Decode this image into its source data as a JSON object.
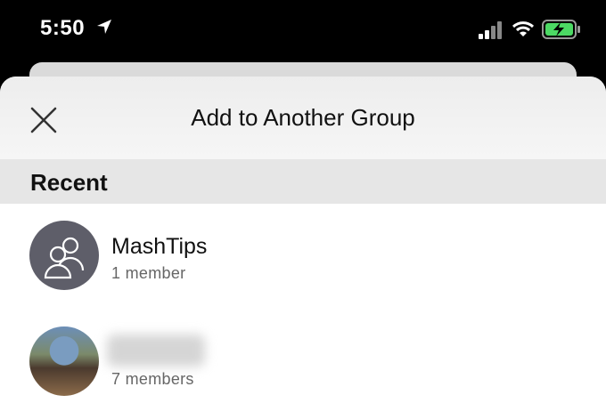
{
  "status_bar": {
    "time": "5:50",
    "icons": [
      "location-arrow-icon",
      "cellular-signal-icon",
      "wifi-icon",
      "battery-charging-icon"
    ],
    "battery_color": "#4cd964"
  },
  "sheet": {
    "title": "Add to Another Group",
    "close_icon": "close-icon"
  },
  "section": {
    "label": "Recent"
  },
  "groups": [
    {
      "name": "MashTips",
      "meta": "1 member",
      "avatar": "group-people-icon"
    },
    {
      "name": "",
      "meta": "7 members",
      "avatar": "group-photo"
    }
  ],
  "colors": {
    "avatar_default": "#5e5e69",
    "section_background": "#e6e6e6"
  }
}
